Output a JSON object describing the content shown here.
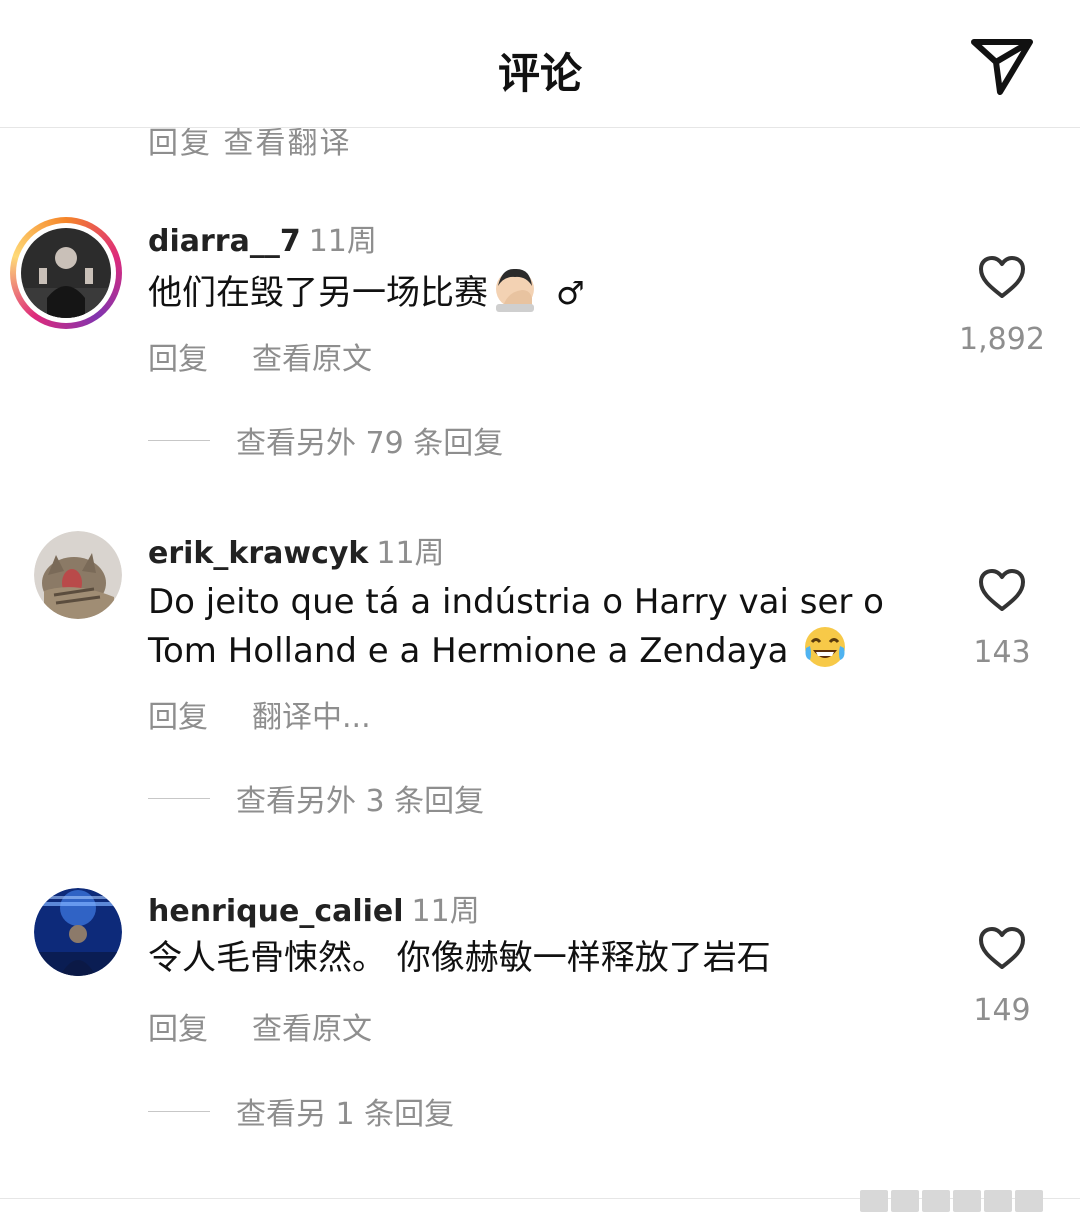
{
  "header": {
    "title": "评论",
    "share_icon": "paper-plane-icon"
  },
  "cutoff_text": "回复    查看翻译",
  "comments": [
    {
      "username": "diarra__7",
      "time": "11周",
      "text": "他们在毁了另一场比赛",
      "emoji": "man-facepalming",
      "trailing_symbol": "♂",
      "reply_label": "回复",
      "secondary_label": "查看原文",
      "likes": "1,892",
      "more_replies": "查看另外 79 条回复",
      "has_story_ring": true
    },
    {
      "username": "erik_krawcyk",
      "time": "11周",
      "text": "Do jeito que tá a indústria o Harry vai ser o Tom Holland e a Hermione a Zendaya",
      "emoji": "face-with-tears-of-joy",
      "reply_label": "回复",
      "secondary_label": "翻译中...",
      "likes": "143",
      "more_replies": "查看另外 3 条回复",
      "has_story_ring": false
    },
    {
      "username": "henrique_caliel",
      "time": "11周",
      "text": "令人毛骨悚然。 你像赫敏一样释放了岩石",
      "reply_label": "回复",
      "secondary_label": "查看原文",
      "likes": "149",
      "more_replies": "查看另 1 条回复",
      "has_story_ring": false
    }
  ]
}
